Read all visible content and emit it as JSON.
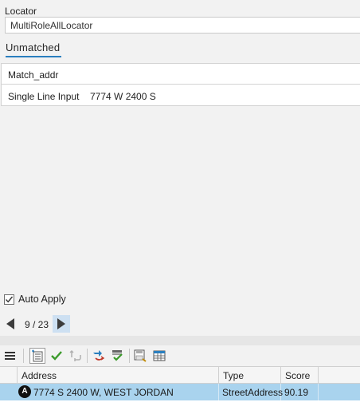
{
  "locator": {
    "label": "Locator",
    "value": "MultiRoleAllLocator"
  },
  "tabs": [
    {
      "label": "Unmatched",
      "active": true
    }
  ],
  "fields": [
    {
      "name": "Match_addr",
      "value": ""
    },
    {
      "name": "Single Line Input",
      "value": "7774 W 2400 S"
    }
  ],
  "auto_apply": {
    "label": "Auto Apply",
    "checked": true
  },
  "pager": {
    "text": "9 / 23"
  },
  "toolbar": {
    "icons": [
      "menu-icon",
      "candidate-icon",
      "match-icon",
      "unmatch-icon",
      "rematch-icon",
      "accept-icon",
      "save-icon",
      "table-icon"
    ]
  },
  "table": {
    "columns": [
      "Address",
      "Type",
      "Score"
    ],
    "rows": [
      {
        "marker": "A",
        "address": "7774 S 2400 W, WEST JORDAN",
        "type": "StreetAddress",
        "score": "90.19"
      }
    ]
  },
  "colors": {
    "accent": "#2a7fbf",
    "selected_row": "#a9d3ee",
    "check_green": "#3a9a2a"
  }
}
